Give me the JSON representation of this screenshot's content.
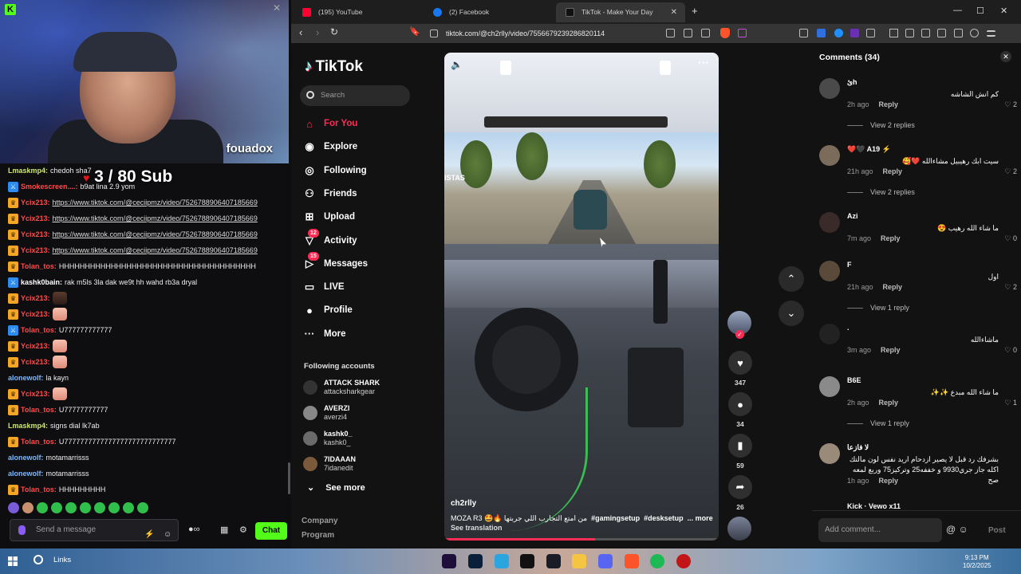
{
  "stream": {
    "streamer_name": "fouadox",
    "sub_goal": "3 / 80 Sub",
    "chat": [
      {
        "user": "Lmaskmp4:",
        "user_color": "#cfe86a",
        "badge": "",
        "text": "chedoh sha7"
      },
      {
        "user": "Smokescreen....:",
        "user_color": "#ff4a4a",
        "badge": "mod",
        "text": "b9at lina 2.9 yom"
      },
      {
        "user": "Ycix213:",
        "user_color": "#ff4a4a",
        "badge": "vip",
        "text": "https://www.tiktok.com/@ceciipmz/video/7526788906407185669",
        "link": true
      },
      {
        "user": "Ycix213:",
        "user_color": "#ff4a4a",
        "badge": "vip",
        "text": "https://www.tiktok.com/@ceciipmz/video/7526788906407185669",
        "link": true
      },
      {
        "user": "Ycix213:",
        "user_color": "#ff4a4a",
        "badge": "vip",
        "text": "https://www.tiktok.com/@ceciipmz/video/7526788906407185669",
        "link": true
      },
      {
        "user": "Ycix213:",
        "user_color": "#ff4a4a",
        "badge": "vip",
        "text": "https://www.tiktok.com/@ceciipmz/video/7526788906407185669",
        "link": true
      },
      {
        "user": "Tolan_tos:",
        "user_color": "#ff4a4a",
        "badge": "vip",
        "text": "HHHHHHHHHHHHHHHHHHHHHHHHHHHHHHHHHHHHHH"
      },
      {
        "user": "kashk0bain:",
        "user_color": "#ffffff",
        "badge": "mod",
        "text": "rak m5ls 3la dak we9t hh wahd rb3a dryal"
      },
      {
        "user": "Ycix213:",
        "user_color": "#ff4a4a",
        "badge": "vip",
        "text": "",
        "emote": "dark"
      },
      {
        "user": "Ycix213:",
        "user_color": "#ff4a4a",
        "badge": "vip",
        "text": "",
        "emote": "light"
      },
      {
        "user": "Tolan_tos:",
        "user_color": "#ff4a4a",
        "badge": "mod",
        "text": "U777777777777"
      },
      {
        "user": "Ycix213:",
        "user_color": "#ff4a4a",
        "badge": "vip",
        "text": "",
        "emote": "light"
      },
      {
        "user": "Ycix213:",
        "user_color": "#ff4a4a",
        "badge": "vip",
        "text": "",
        "emote": "light"
      },
      {
        "user": "alonewolf:",
        "user_color": "#7ab8ff",
        "badge": "",
        "text": "la kayn"
      },
      {
        "user": "Ycix213:",
        "user_color": "#ff4a4a",
        "badge": "vip",
        "text": "",
        "emote": "light"
      },
      {
        "user": "Tolan_tos:",
        "user_color": "#ff4a4a",
        "badge": "vip",
        "text": "U77777777777"
      },
      {
        "user": "Lmaskmp4:",
        "user_color": "#cfe86a",
        "badge": "",
        "text": "signs dial lk7ab"
      },
      {
        "user": "Tolan_tos:",
        "user_color": "#ff4a4a",
        "badge": "vip",
        "text": "U7777777777777777777777777777"
      },
      {
        "user": "alonewolf:",
        "user_color": "#7ab8ff",
        "badge": "",
        "text": "motamarrisss"
      },
      {
        "user": "alonewolf:",
        "user_color": "#7ab8ff",
        "badge": "",
        "text": "motamarrisss"
      },
      {
        "user": "Tolan_tos:",
        "user_color": "#ff4a4a",
        "badge": "vip",
        "text": "HHHHHHHHH"
      }
    ],
    "chat_placeholder": "Send a message",
    "chat_button": "Chat",
    "accent": "#53fc18"
  },
  "browser": {
    "tabs": [
      {
        "label": "(195) YouTube",
        "icon": "youtube-icon"
      },
      {
        "label": "(2) Facebook",
        "icon": "facebook-icon"
      },
      {
        "label": "TikTok - Make Your Day",
        "icon": "tiktok-icon"
      }
    ],
    "url": "tiktok.com/@ch2rlly/video/7556679239286820114"
  },
  "tiktok": {
    "logo": "TikTok",
    "search_placeholder": "Search",
    "nav": [
      {
        "label": "For You",
        "icon": "home-icon",
        "active": true
      },
      {
        "label": "Explore",
        "icon": "compass-icon"
      },
      {
        "label": "Following",
        "icon": "following-icon"
      },
      {
        "label": "Friends",
        "icon": "friends-icon"
      },
      {
        "label": "Upload",
        "icon": "upload-icon"
      },
      {
        "label": "Activity",
        "icon": "activity-icon",
        "count": "12"
      },
      {
        "label": "Messages",
        "icon": "messages-icon",
        "count": "15"
      },
      {
        "label": "LIVE",
        "icon": "live-icon"
      },
      {
        "label": "Profile",
        "icon": "profile-icon"
      },
      {
        "label": "More",
        "icon": "more-icon"
      }
    ],
    "following_header": "Following accounts",
    "following": [
      {
        "name": "ATTACK SHARK",
        "handle": "attacksharkgear"
      },
      {
        "name": "AVERZI",
        "handle": "averzi4"
      },
      {
        "name": "kashk0_",
        "handle": "kashk0_"
      },
      {
        "name": "7IDAAAN",
        "handle": "7idanedit"
      }
    ],
    "see_more": "See more",
    "footer": [
      "Company",
      "Program"
    ],
    "video": {
      "author": "ch2rlly",
      "caption": "من امتع التجارب اللي جربتها 🔥🤩 MOZA R3",
      "hashtags": [
        "#gamingsetup",
        "#desksetup"
      ],
      "more": "... more",
      "see_translation": "See translation",
      "in_video_sign": "ISTAS",
      "progress_percent": 55
    },
    "actions": {
      "likes": "347",
      "comments": "34",
      "saves": "59",
      "shares": "26"
    },
    "comments_title": "Comments (34)",
    "comments": [
      {
        "user": "ئ‌h ",
        "text": "كم انش الشاشه",
        "time": "2h ago",
        "reply": "Reply",
        "likes": "2",
        "replies": "View 2 replies"
      },
      {
        "user": "❤️🖤 A19 ⚡",
        "text": "سيت ابك رهيبيل مشاءالله ❤️🥰",
        "time": "21h ago",
        "reply": "Reply",
        "likes": "2",
        "replies": "View 2 replies"
      },
      {
        "user": "Azi",
        "text": "ما شاء الله رهيب 😍",
        "time": "7m ago",
        "reply": "Reply",
        "likes": "0"
      },
      {
        "user": "F",
        "text": "اول",
        "time": "21h ago",
        "reply": "Reply",
        "likes": "2",
        "replies": "View 1 reply"
      },
      {
        "user": ".",
        "text": "ماشاءالله",
        "time": "3m ago",
        "reply": "Reply",
        "likes": "0"
      },
      {
        "user": "B6E",
        "text": "ما شاء الله مبدع ✨✨",
        "time": "2h ago",
        "reply": "Reply",
        "likes": "1",
        "replies": "View 1 reply"
      },
      {
        "user": "لا فازعا",
        "text": "بشرفك رد قبل لا يصير ازدحام اريد نفس لون مالتك اكله جاز جري9930 و خففه25 وتركيز75 وربع لمعه صح",
        "time": "1h ago",
        "reply": "Reply"
      }
    ],
    "comments_last_user": "Kick · Vewo x11",
    "comment_placeholder": "Add comment...",
    "post_label": "Post",
    "accent": "#fe2c55"
  },
  "taskbar": {
    "search_label": "Links",
    "time": "9:13 PM",
    "date": "10/2/2025"
  }
}
